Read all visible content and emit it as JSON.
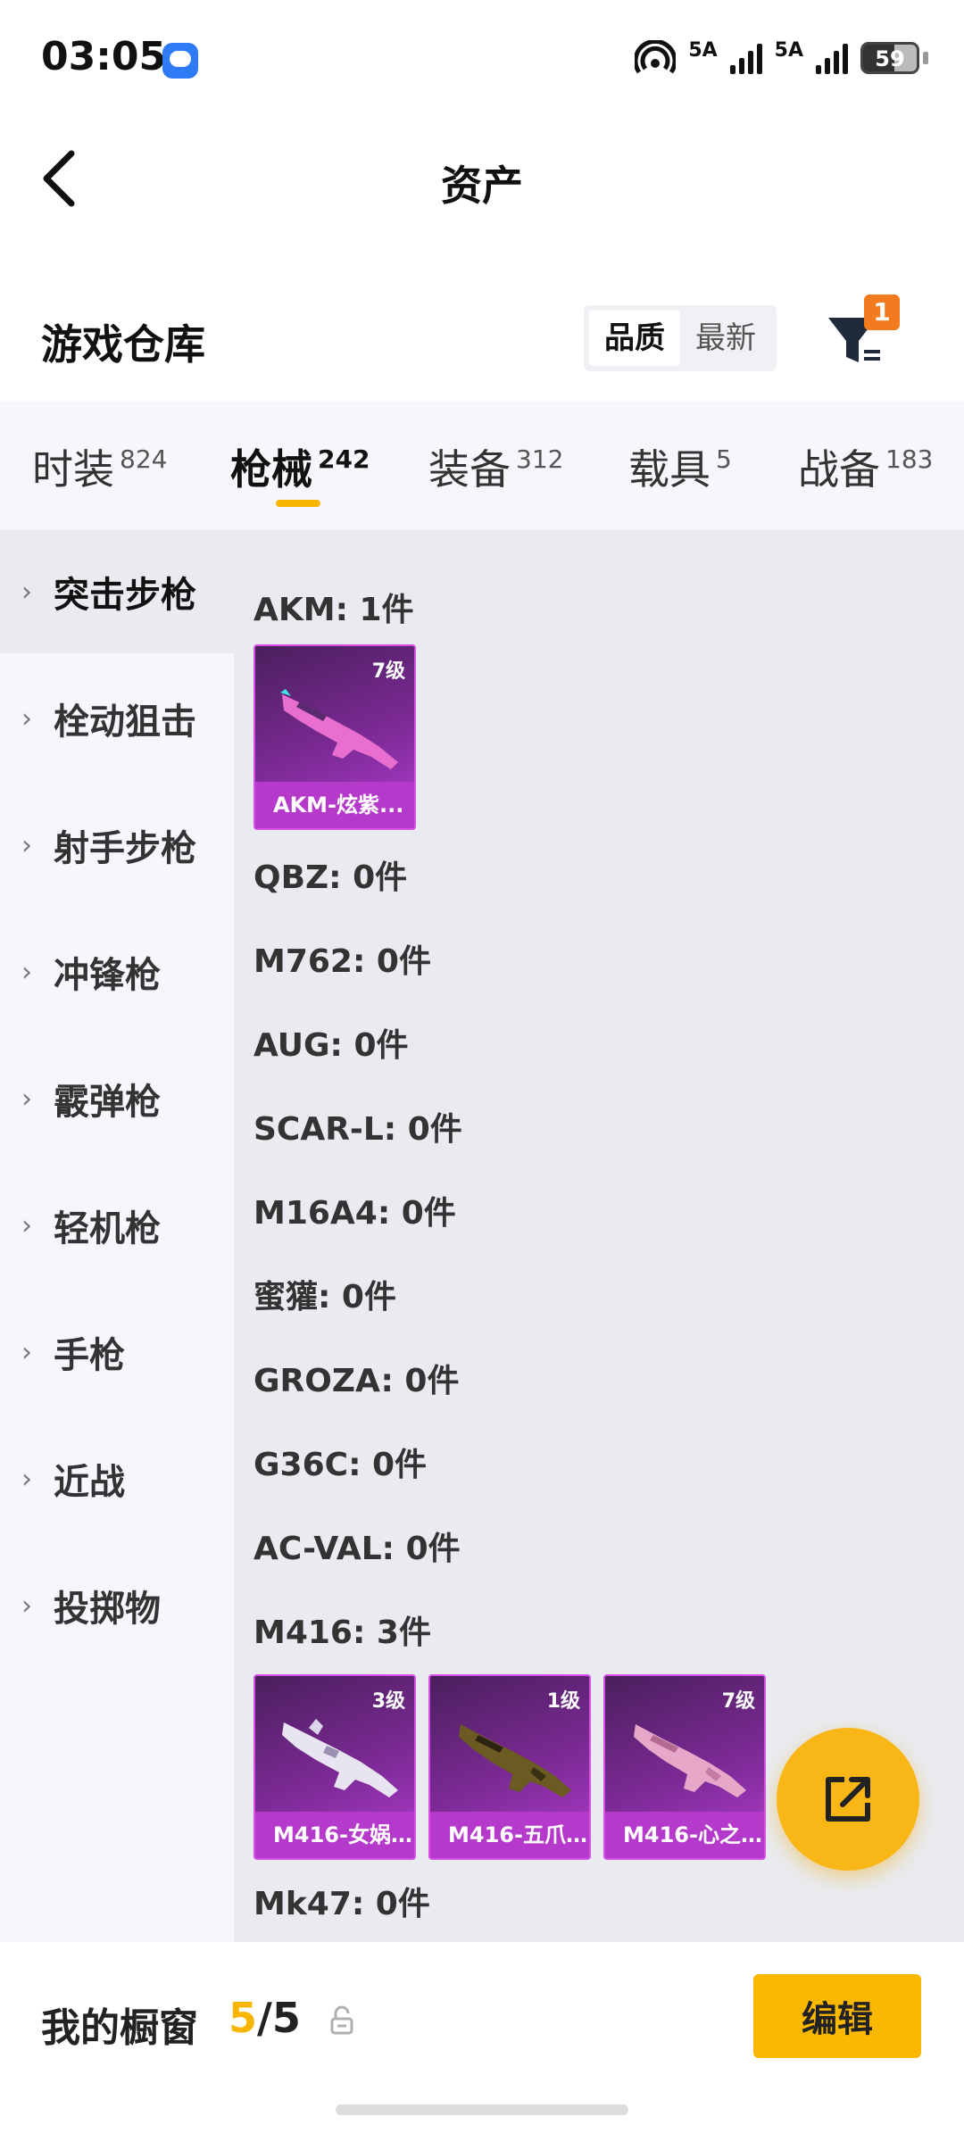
{
  "status_bar": {
    "time": "03:05",
    "network_1": "5A",
    "network_2": "5A",
    "battery": "59",
    "battery_level": 0.59
  },
  "header": {
    "title": "资产"
  },
  "warehouse": {
    "title": "游戏仓库",
    "sort_options": [
      "品质",
      "最新"
    ],
    "sort_selected": "品质",
    "filter_badge": "1"
  },
  "tabs": [
    {
      "label": "时装",
      "count": "824"
    },
    {
      "label": "枪械",
      "count": "242"
    },
    {
      "label": "装备",
      "count": "312"
    },
    {
      "label": "载具",
      "count": "5"
    },
    {
      "label": "战备",
      "count": "183"
    }
  ],
  "active_tab": "枪械",
  "sidebar": {
    "items": [
      {
        "label": "突击步枪"
      },
      {
        "label": "栓动狙击"
      },
      {
        "label": "射手步枪"
      },
      {
        "label": "冲锋枪"
      },
      {
        "label": "霰弹枪"
      },
      {
        "label": "轻机枪"
      },
      {
        "label": "手枪"
      },
      {
        "label": "近战"
      },
      {
        "label": "投掷物"
      }
    ],
    "active": "突击步枪"
  },
  "content": {
    "groups": [
      {
        "label": "AKM: 1件",
        "items": [
          {
            "name": "AKM-炫紫...",
            "level": "7级"
          }
        ]
      },
      {
        "label": "QBZ: 0件"
      },
      {
        "label": "M762: 0件"
      },
      {
        "label": "AUG: 0件"
      },
      {
        "label": "SCAR-L: 0件"
      },
      {
        "label": "M16A4: 0件"
      },
      {
        "label": "蜜獾: 0件"
      },
      {
        "label": "GROZA: 0件"
      },
      {
        "label": "G36C: 0件"
      },
      {
        "label": "AC-VAL: 0件"
      },
      {
        "label": "M416: 3件",
        "items": [
          {
            "name": "M416-女娲...",
            "level": "3级"
          },
          {
            "name": "M416-五爪...",
            "level": "1级"
          },
          {
            "name": "M416-心之...",
            "level": "7级"
          }
        ]
      },
      {
        "label": "Mk47: 0件"
      }
    ]
  },
  "bottom_bar": {
    "showcase_label": "我的橱窗",
    "showcase_current": "5",
    "showcase_sep": "/",
    "showcase_total": "5",
    "edit_label": "编辑"
  },
  "colors": {
    "accent": "#f7b500",
    "item_purple": "#b53acb",
    "badge_orange": "#f47a1f"
  }
}
